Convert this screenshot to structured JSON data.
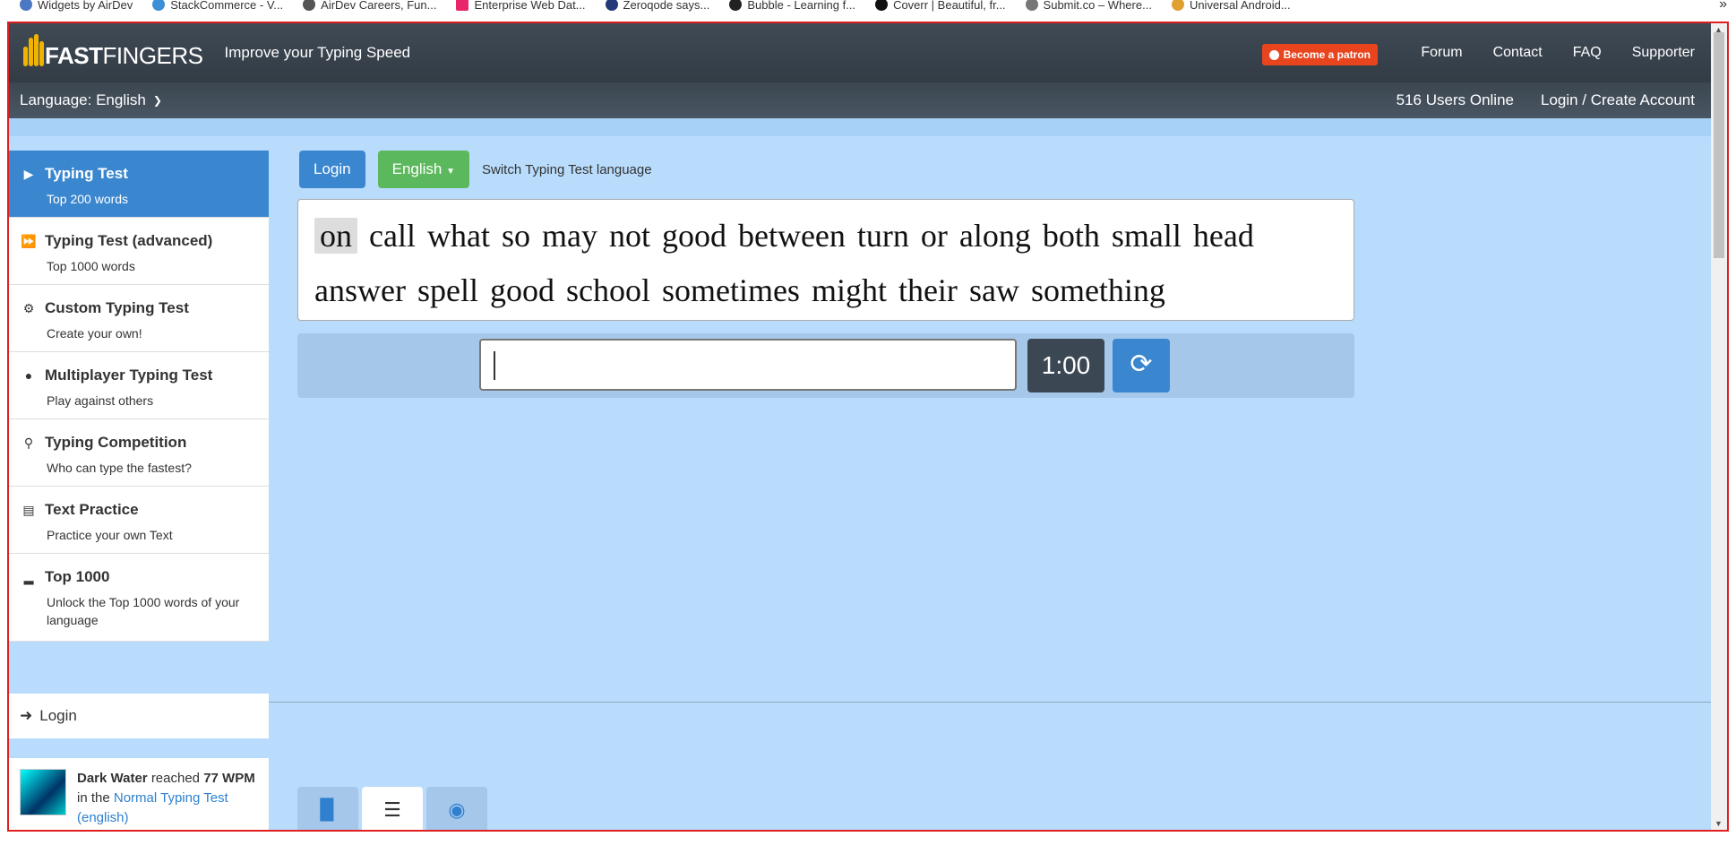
{
  "bookmarks": [
    {
      "label": "Widgets by AirDev"
    },
    {
      "label": "StackCommerce - V..."
    },
    {
      "label": "AirDev Careers, Fun..."
    },
    {
      "label": "Enterprise Web Dat..."
    },
    {
      "label": "Zeroqode says..."
    },
    {
      "label": "Bubble - Learning f..."
    },
    {
      "label": "Coverr | Beautiful, fr..."
    },
    {
      "label": "Submit.co – Where..."
    },
    {
      "label": "Universal Android..."
    }
  ],
  "bookmarks_more": "»",
  "header": {
    "logo_bold": "FAST",
    "logo_rest": "FINGERS",
    "tagline": "Improve your Typing Speed",
    "patron_label": "Become a patron",
    "nav": [
      "Forum",
      "Contact",
      "FAQ",
      "Supporter"
    ],
    "language_label": "Language: English",
    "users_online": "516 Users Online",
    "login_create": "Login / Create Account"
  },
  "sidebar": {
    "items": [
      {
        "title": "Typing Test",
        "sub": "Top 200 words",
        "icon": "play-icon"
      },
      {
        "title": "Typing Test (advanced)",
        "sub": "Top 1000 words",
        "icon": "fast-forward-icon"
      },
      {
        "title": "Custom Typing Test",
        "sub": "Create your own!",
        "icon": "gears-icon"
      },
      {
        "title": "Multiplayer Typing Test",
        "sub": "Play against others",
        "icon": "users-icon"
      },
      {
        "title": "Typing Competition",
        "sub": "Who can type the fastest?",
        "icon": "trophy-icon"
      },
      {
        "title": "Text Practice",
        "sub": "Practice your own Text",
        "icon": "document-icon"
      },
      {
        "title": "Top 1000",
        "sub": "Unlock the Top 1000 words of your language",
        "icon": "signal-icon"
      }
    ],
    "login": "Login",
    "activity": {
      "user": "Dark Water",
      "reached": "reached",
      "wpm": "77 WPM",
      "in_the": "in the",
      "test_link": "Normal Typing Test (english)"
    }
  },
  "main": {
    "login_button": "Login",
    "language_button": "English",
    "switch_text": "Switch Typing Test language",
    "words_line1": [
      "on",
      "call",
      "what",
      "so",
      "may",
      "not",
      "good",
      "between",
      "turn",
      "or",
      "along",
      "both",
      "small",
      "head"
    ],
    "words_line2": [
      "answer",
      "spell",
      "good",
      "school",
      "sometimes",
      "might",
      "their",
      "saw",
      "something"
    ],
    "timer": "1:00",
    "input_value": ""
  },
  "colors": {
    "accent_blue": "#3a87d0",
    "green": "#5cb85c",
    "patron": "#e8451f",
    "background": "#b9dcfc"
  }
}
